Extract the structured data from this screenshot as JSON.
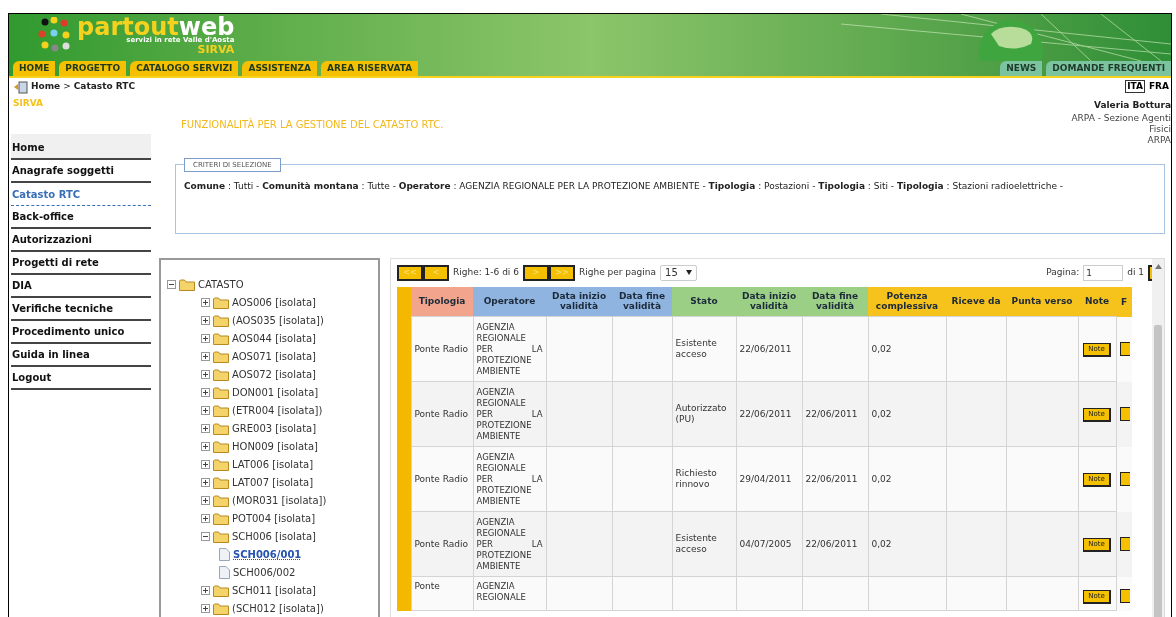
{
  "header": {
    "wordmark": [
      "partout",
      "web"
    ],
    "tagline": "servizi in rete Valle d'Aosta",
    "subtitle": "SIRVA",
    "nav": [
      {
        "label": "HOME"
      },
      {
        "label": "PROGETTO"
      },
      {
        "label": "CATALOGO SERVIZI"
      },
      {
        "label": "ASSISTENZA"
      },
      {
        "label": "AREA RISERVATA"
      }
    ],
    "nav_right": [
      {
        "label": "NEWS"
      },
      {
        "label": "DOMANDE FREQUENTI"
      }
    ]
  },
  "breadcrumb": {
    "items": [
      "Home",
      "Catasto RTC"
    ],
    "separator": ">"
  },
  "languages": [
    {
      "label": "ITA",
      "selected": true
    },
    {
      "label": "FRA",
      "selected": false
    }
  ],
  "user": {
    "name": "Valeria Bottura",
    "org": "ARPA - Sezione Agenti Fisici",
    "entity": "ARPA"
  },
  "section": "SIRVA",
  "page_title": "FUNZIONALITÀ PER LA GESTIONE DEL CATASTO RTC.",
  "sidebar": {
    "items": [
      {
        "label": "Home",
        "kind": "top",
        "selected": false
      },
      {
        "label": "Anagrafe soggetti",
        "kind": "link",
        "selected": false
      },
      {
        "label": "Catasto RTC",
        "kind": "link",
        "selected": true
      },
      {
        "label": "Back-office",
        "kind": "link",
        "selected": false
      },
      {
        "label": "Autorizzazioni",
        "kind": "link",
        "selected": false
      },
      {
        "label": "Progetti di rete",
        "kind": "link",
        "selected": false
      },
      {
        "label": "DIA",
        "kind": "link",
        "selected": false
      },
      {
        "label": "Verifiche tecniche",
        "kind": "link",
        "selected": false
      },
      {
        "label": "Procedimento unico",
        "kind": "link",
        "selected": false
      },
      {
        "label": "Guida in linea",
        "kind": "link",
        "selected": false
      },
      {
        "label": "Logout",
        "kind": "link",
        "selected": false
      }
    ]
  },
  "criteria": {
    "legend": "CRITERI DI SELEZIONE",
    "text": "**Comune** : Tutti - **Comunità montana** : Tutte - **Operatore** : AGENZIA REGIONALE PER LA PROTEZIONE AMBIENTE - **Tipologia** : Postazioni - **Tipologia** : Siti - **Tipologia** : Stazioni radioelettriche -"
  },
  "tree": {
    "label": "CATASTO",
    "kind": "folder",
    "expanded": true,
    "selected": false,
    "children": [
      {
        "label": "AOS006 [isolata]",
        "kind": "folder",
        "expanded": false,
        "selected": false
      },
      {
        "label": "(AOS035 [isolata])",
        "kind": "folder",
        "expanded": false,
        "selected": false
      },
      {
        "label": "AOS044 [isolata]",
        "kind": "folder",
        "expanded": false,
        "selected": false
      },
      {
        "label": "AOS071 [isolata]",
        "kind": "folder",
        "expanded": false,
        "selected": false
      },
      {
        "label": "AOS072 [isolata]",
        "kind": "folder",
        "expanded": false,
        "selected": false
      },
      {
        "label": "DON001 [isolata]",
        "kind": "folder",
        "expanded": false,
        "selected": false
      },
      {
        "label": "(ETR004 [isolata])",
        "kind": "folder",
        "expanded": false,
        "selected": false
      },
      {
        "label": "GRE003 [isolata]",
        "kind": "folder",
        "expanded": false,
        "selected": false
      },
      {
        "label": "HON009 [isolata]",
        "kind": "folder",
        "expanded": false,
        "selected": false
      },
      {
        "label": "LAT006 [isolata]",
        "kind": "folder",
        "expanded": false,
        "selected": false
      },
      {
        "label": "LAT007 [isolata]",
        "kind": "folder",
        "expanded": false,
        "selected": false
      },
      {
        "label": "(MOR031 [isolata])",
        "kind": "folder",
        "expanded": false,
        "selected": false
      },
      {
        "label": "POT004 [isolata]",
        "kind": "folder",
        "expanded": false,
        "selected": false
      },
      {
        "label": "SCH006 [isolata]",
        "kind": "folder",
        "expanded": true,
        "selected": false,
        "children": [
          {
            "label": "SCH006/001",
            "kind": "file",
            "selected": true
          },
          {
            "label": "SCH006/002",
            "kind": "file",
            "selected": false
          }
        ]
      },
      {
        "label": "SCH011 [isolata]",
        "kind": "folder",
        "expanded": false,
        "selected": false
      },
      {
        "label": "(SCH012 [isolata])",
        "kind": "folder",
        "expanded": false,
        "selected": false
      }
    ]
  },
  "pagination": {
    "first": "<<",
    "prev": "<",
    "next": ">",
    "last": ">>",
    "rows_info": "Righe: 1-6 di 6",
    "per_page_label": "Righe per pagina",
    "per_page": "15",
    "page_label": "Pagina:",
    "page": "1",
    "page_total": "di 1"
  },
  "table": {
    "columns": [
      {
        "label": "Tipologia",
        "color": "#f2a58c"
      },
      {
        "label": "Operatore",
        "color": "#90b4e0"
      },
      {
        "label": "Data inizio validità",
        "color": "#90b4e0"
      },
      {
        "label": "Data fine validità",
        "color": "#90b4e0"
      },
      {
        "label": "Stato",
        "color": "#9ccf86"
      },
      {
        "label": "Data inizio validità",
        "color": "#9ccf86"
      },
      {
        "label": "Data fine validità",
        "color": "#9ccf86"
      },
      {
        "label": "Potenza complessiva",
        "color": "#f6c21c"
      },
      {
        "label": "Riceve da",
        "color": "#f6c21c"
      },
      {
        "label": "Punta verso",
        "color": "#f6c21c"
      },
      {
        "label": "Note",
        "color": "#f6c21c"
      },
      {
        "label": "F",
        "color": "#f6c21c"
      }
    ],
    "rows": [
      {
        "cells": [
          "Ponte Radio",
          "AGENZIA REGIONALE PER LA PROTEZIONE AMBIENTE",
          null,
          null,
          "Esistente acceso",
          "22/06/2011",
          null,
          "0,02",
          null,
          null
        ],
        "note": "Note"
      },
      {
        "cells": [
          "Ponte Radio",
          "AGENZIA REGIONALE PER LA PROTEZIONE AMBIENTE",
          null,
          null,
          "Autorizzato (PU)",
          "22/06/2011",
          "22/06/2011",
          "0,02",
          null,
          null
        ],
        "note": "Note"
      },
      {
        "cells": [
          "Ponte Radio",
          "AGENZIA REGIONALE PER LA PROTEZIONE AMBIENTE",
          null,
          null,
          "Richiesto rinnovo",
          "29/04/2011",
          "22/06/2011",
          "0,02",
          null,
          null
        ],
        "note": "Note"
      },
      {
        "cells": [
          "Ponte Radio",
          "AGENZIA REGIONALE PER LA PROTEZIONE AMBIENTE",
          null,
          null,
          "Esistente acceso",
          "04/07/2005",
          "22/06/2011",
          "0,02",
          null,
          null
        ],
        "note": "Note"
      },
      {
        "cells": [
          "Ponte",
          "AGENZIA REGIONALE",
          null,
          null,
          null,
          null,
          null,
          null,
          null,
          null
        ],
        "note": "Note"
      }
    ]
  }
}
